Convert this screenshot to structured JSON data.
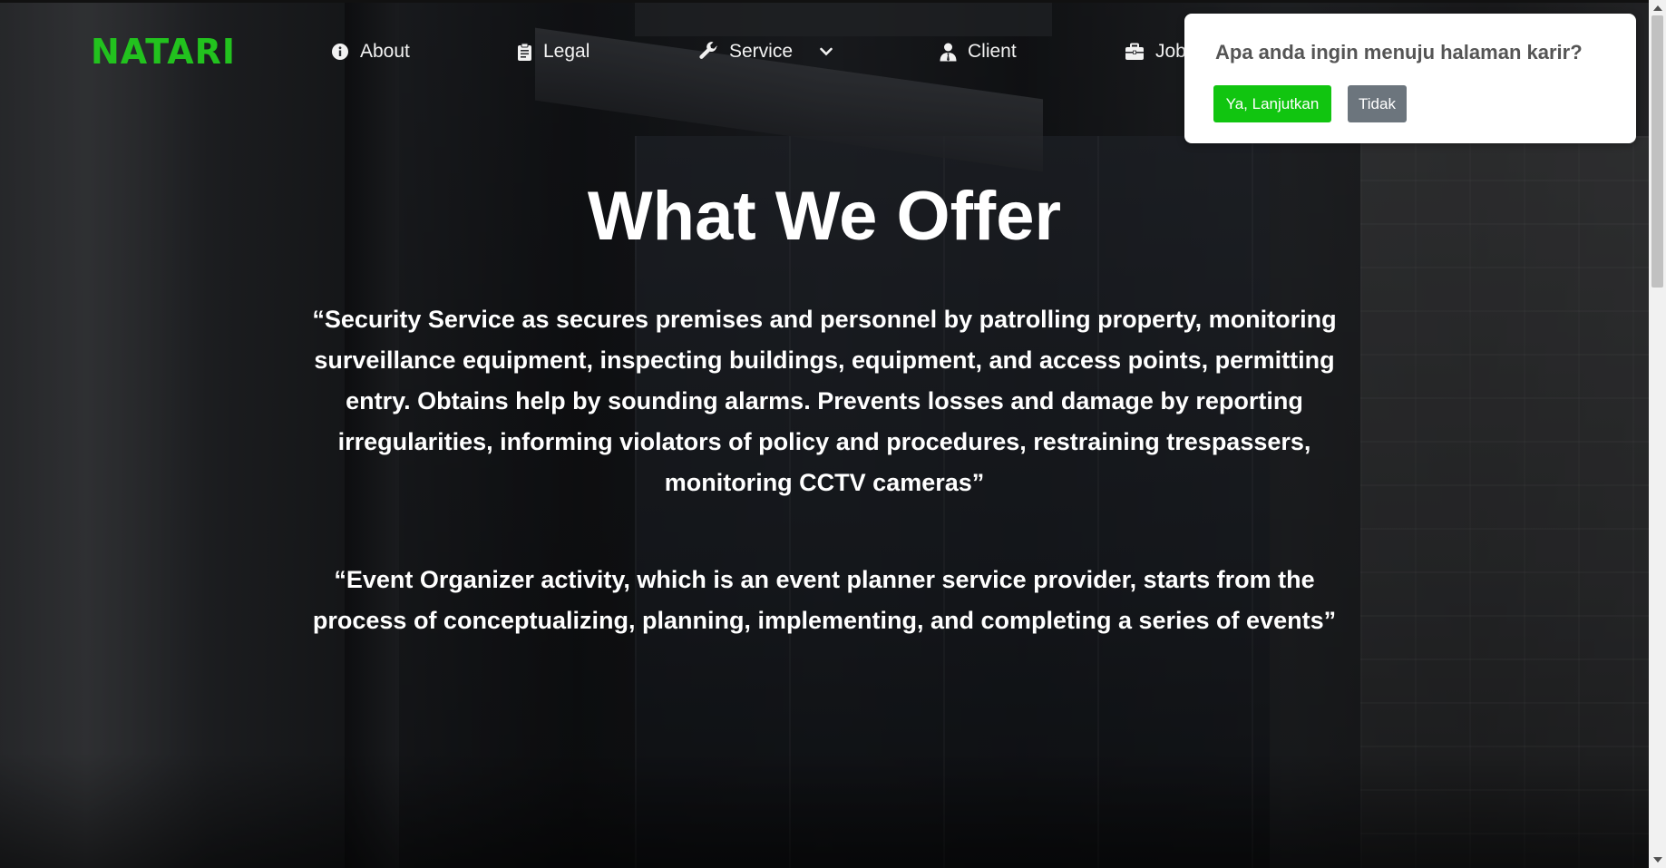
{
  "brand": {
    "logo_text": "NATARI",
    "accent_color": "#22c21e"
  },
  "nav": {
    "items": [
      {
        "label": "About",
        "icon": "info-circle-icon"
      },
      {
        "label": "Legal",
        "icon": "clipboard-icon"
      },
      {
        "label": "Service",
        "icon": "wrench-icon",
        "has_dropdown": true
      },
      {
        "label": "Client",
        "icon": "user-tie-icon"
      },
      {
        "label": "Job",
        "icon": "briefcase-icon"
      }
    ]
  },
  "hero": {
    "title": "What We Offer",
    "paragraphs": [
      "“Security Service as secures premises and personnel by patrolling property, monitoring surveillance equipment, inspecting buildings, equipment, and access points, permitting entry. Obtains help by sounding alarms. Prevents losses and damage by reporting irregularities, informing violators of policy and procedures, restraining trespassers, monitoring CCTV cameras”",
      "“Event Organizer activity, which is an event planner service provider, starts from the process of conceptualizing, planning, implementing, and completing a series of events”"
    ]
  },
  "dialog": {
    "message": "Apa anda ingin menuju halaman karir?",
    "confirm_label": "Ya, Lanjutkan",
    "cancel_label": "Tidak",
    "confirm_color": "#11c510",
    "cancel_color": "#6c757d"
  }
}
